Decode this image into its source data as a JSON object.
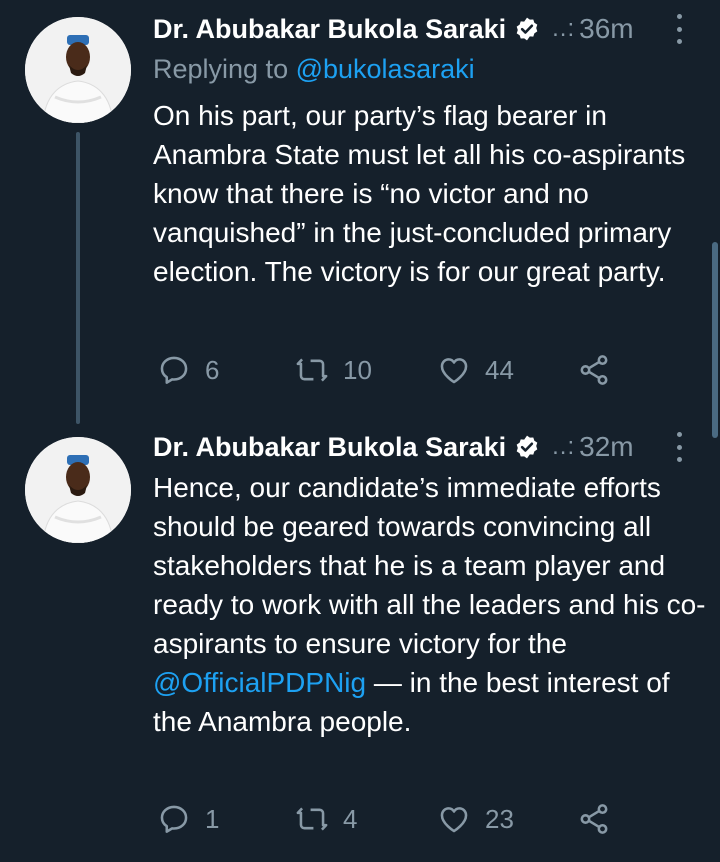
{
  "tweets": [
    {
      "author": "Dr. Abubakar Bukola Saraki",
      "separator": "..:",
      "time": "36m",
      "replying_prefix": "Replying to ",
      "replying_handle": "@bukolasaraki",
      "text": "On his part, our party’s flag bearer in Anambra State must let all his co-aspirants know that there is “no victor and no vanquished” in the just-concluded primary election. The victory is for our great party.",
      "replies": "6",
      "retweets": "10",
      "likes": "44"
    },
    {
      "author": "Dr. Abubakar Bukola Saraki",
      "separator": "..:",
      "time": "32m",
      "text_before_mention": "Hence, our candidate’s immediate efforts should be geared towards convincing all stakeholders that he is a team player and ready to work with all the leaders and his co-aspirants to ensure victory for the ",
      "mention": "@OfficialPDPNig",
      "text_after_mention": " — in the best interest of the Anambra people.",
      "replies": "1",
      "retweets": "4",
      "likes": "23"
    }
  ],
  "icons": {
    "verified": "verified-badge-icon",
    "reply": "reply-icon",
    "retweet": "retweet-icon",
    "like": "heart-icon",
    "share": "share-icon",
    "more": "more-vertical-icon"
  },
  "colors": {
    "background": "#15202b",
    "secondary_text": "#8899a6",
    "link": "#1da1f2",
    "thread_line": "#3d5466"
  }
}
